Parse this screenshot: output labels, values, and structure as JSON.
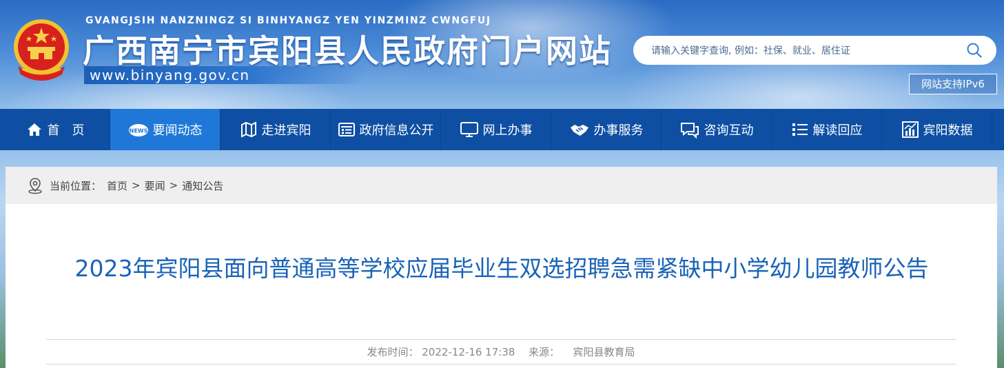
{
  "header": {
    "pinyin": "GVANGJSIH NANZNINGZ SI BINHYANGZ YEN YINZMINZ CWNGFUJ",
    "title": "广西南宁市宾阳县人民政府门户网站",
    "url": "www.binyang.gov.cn",
    "search_placeholder": "请输入关键字查询, 例如：社保、就业、居住证",
    "ipv6_label": "网站支持IPv6",
    "emblem_icon": "national-emblem-icon",
    "search_icon": "search-icon"
  },
  "nav": {
    "items": [
      {
        "label": "首　页",
        "icon": "home-icon",
        "active": false
      },
      {
        "label": "要闻动态",
        "icon": "news-icon",
        "active": true
      },
      {
        "label": "走进宾阳",
        "icon": "map-icon",
        "active": false
      },
      {
        "label": "政府信息公开",
        "icon": "info-list-icon",
        "active": false
      },
      {
        "label": "网上办事",
        "icon": "monitor-icon",
        "active": false
      },
      {
        "label": "办事服务",
        "icon": "handshake-icon",
        "active": false
      },
      {
        "label": "咨询互动",
        "icon": "chat-icon",
        "active": false
      },
      {
        "label": "解读回应",
        "icon": "list-icon",
        "active": false
      },
      {
        "label": "宾阳数据",
        "icon": "chart-icon",
        "active": false
      }
    ],
    "active_color": "#1f78d8",
    "bar_color": "#0e4fa3"
  },
  "breadcrumb": {
    "prefix": "当前位置：",
    "items": [
      "首页",
      "要闻",
      "通知公告"
    ],
    "separator": ">"
  },
  "article": {
    "title": "2023年宾阳县面向普通高等学校应届毕业生双选招聘急需紧缺中小学幼儿园教师公告",
    "publish_label": "发布时间：",
    "publish_time": "2022-12-16 17:38",
    "source_label": "来源：",
    "source": "宾阳县教育局",
    "title_color": "#1a63b7"
  }
}
